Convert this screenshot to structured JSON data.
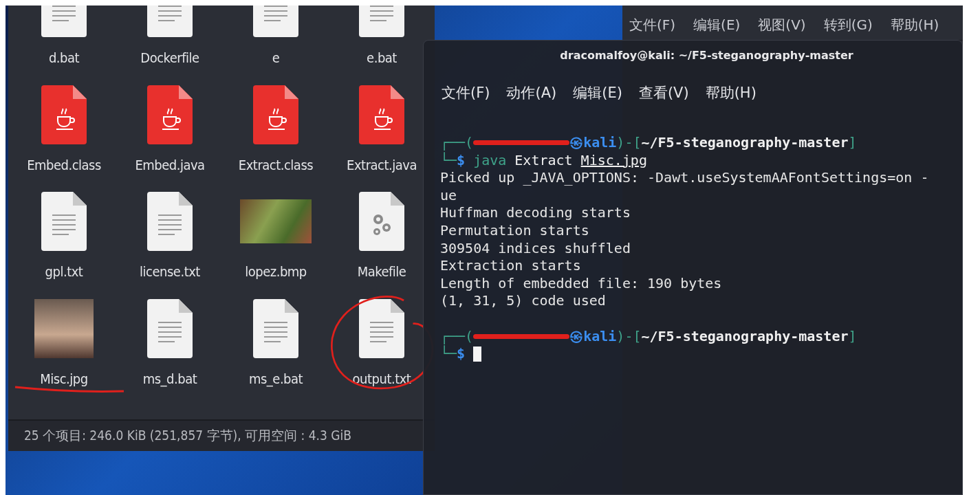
{
  "back_window": {
    "menu": [
      "文件(F)",
      "编辑(E)",
      "视图(V)",
      "转到(G)",
      "帮助(H)"
    ]
  },
  "file_manager": {
    "files": [
      {
        "name": "d.bat",
        "kind": "text"
      },
      {
        "name": "Dockerfile",
        "kind": "text"
      },
      {
        "name": "e",
        "kind": "text"
      },
      {
        "name": "e.bat",
        "kind": "text"
      },
      {
        "name": "Embed.class",
        "kind": "java"
      },
      {
        "name": "Embed.java",
        "kind": "java"
      },
      {
        "name": "Extract.class",
        "kind": "java"
      },
      {
        "name": "Extract.java",
        "kind": "java"
      },
      {
        "name": "gpl.txt",
        "kind": "text"
      },
      {
        "name": "license.txt",
        "kind": "text"
      },
      {
        "name": "lopez.bmp",
        "kind": "image"
      },
      {
        "name": "Makefile",
        "kind": "makefile"
      },
      {
        "name": "Misc.jpg",
        "kind": "photo",
        "annotation": {
          "kind": "underline"
        }
      },
      {
        "name": "ms_d.bat",
        "kind": "text"
      },
      {
        "name": "ms_e.bat",
        "kind": "text"
      },
      {
        "name": "output.txt",
        "kind": "text",
        "annotation": {
          "kind": "circle"
        }
      }
    ],
    "status": "25 个项目: 246.0 KiB (251,857 字节), 可用空间 : 4.3 GiB"
  },
  "terminal": {
    "title": "dracomalfoy@kali: ~/F5-steganography-master",
    "menu": [
      "文件(F)",
      "动作(A)",
      "编辑(E)",
      "查看(V)",
      "帮助(H)"
    ],
    "lines": [
      {
        "kind": "prompt",
        "open": "┌──(",
        "user_redacted": true,
        "host": "㉿kali",
        "mid": ")-[",
        "path": "~/F5-steganography-master",
        "close": "]",
        "corner": "└─",
        "sign": "$",
        "command": "java",
        "args": "Extract",
        "file": "Misc.jpg",
        "cursor": false
      },
      {
        "kind": "output",
        "text": "Picked up _JAVA_OPTIONS: -Dawt.useSystemAAFontSettings=on -"
      },
      {
        "kind": "output",
        "text": "ue"
      },
      {
        "kind": "output",
        "text": "Huffman decoding starts"
      },
      {
        "kind": "output",
        "text": "Permutation starts"
      },
      {
        "kind": "output",
        "text": "309504 indices shuffled"
      },
      {
        "kind": "output",
        "text": "Extraction starts"
      },
      {
        "kind": "output",
        "text": "Length of embedded file: 190 bytes"
      },
      {
        "kind": "output",
        "text": "(1, 31, 5) code used"
      },
      {
        "kind": "blank"
      },
      {
        "kind": "prompt",
        "open": "┌──(",
        "user_redacted": true,
        "host": "㉿kali",
        "mid": ")-[",
        "path": "~/F5-steganography-master",
        "close": "]",
        "corner": "└─",
        "sign": "$",
        "cursor": true
      }
    ]
  }
}
